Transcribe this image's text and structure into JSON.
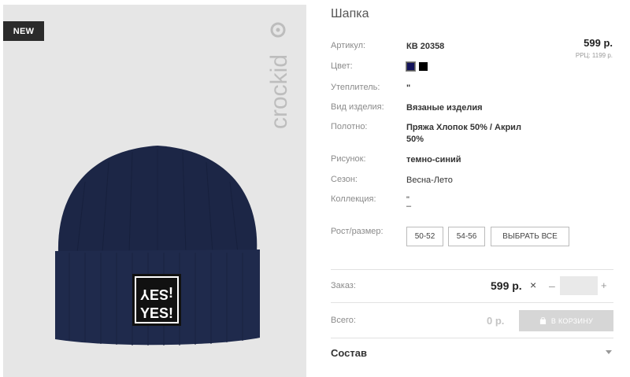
{
  "product": {
    "title": "Шапка",
    "badge": "NEW",
    "brand": "crockid",
    "patch_line1": "¡SƎY",
    "patch_line2": "YES!"
  },
  "price": {
    "main": "599 р.",
    "rrp": "РРЦ: 1199 р."
  },
  "attrs": {
    "article_label": "Артикул:",
    "article_value": "КВ 20358",
    "color_label": "Цвет:",
    "insulation_label": "Утеплитель:",
    "insulation_value": "\"",
    "type_label": "Вид изделия:",
    "type_value": "Вязаные изделия",
    "fabric_label": "Полотно:",
    "fabric_value_1": "Пряжа Хлопок 50% / Акрил",
    "fabric_value_2": "50%",
    "pattern_label": "Рисунок:",
    "pattern_value": "темно-синий",
    "season_label": "Сезон:",
    "season_value": "Весна-Лето",
    "collection_label": "Коллекция:",
    "collection_value_1": "\"",
    "collection_value_2": "–"
  },
  "colors": [
    {
      "name": "navy",
      "hex": "#14145c",
      "selected": true
    },
    {
      "name": "black",
      "hex": "#000000",
      "selected": false
    }
  ],
  "sizes": {
    "label": "Рост/размер:",
    "options": [
      "50-52",
      "54-56"
    ],
    "select_all": "ВЫБРАТЬ ВСЕ"
  },
  "order": {
    "label": "Заказ:",
    "price": "599 р.",
    "times": "×",
    "minus": "–",
    "plus": "+",
    "qty": ""
  },
  "total": {
    "label": "Всего:",
    "value": "0 р.",
    "cart_button": "В КОРЗИНУ"
  },
  "composition": {
    "label": "Состав"
  }
}
